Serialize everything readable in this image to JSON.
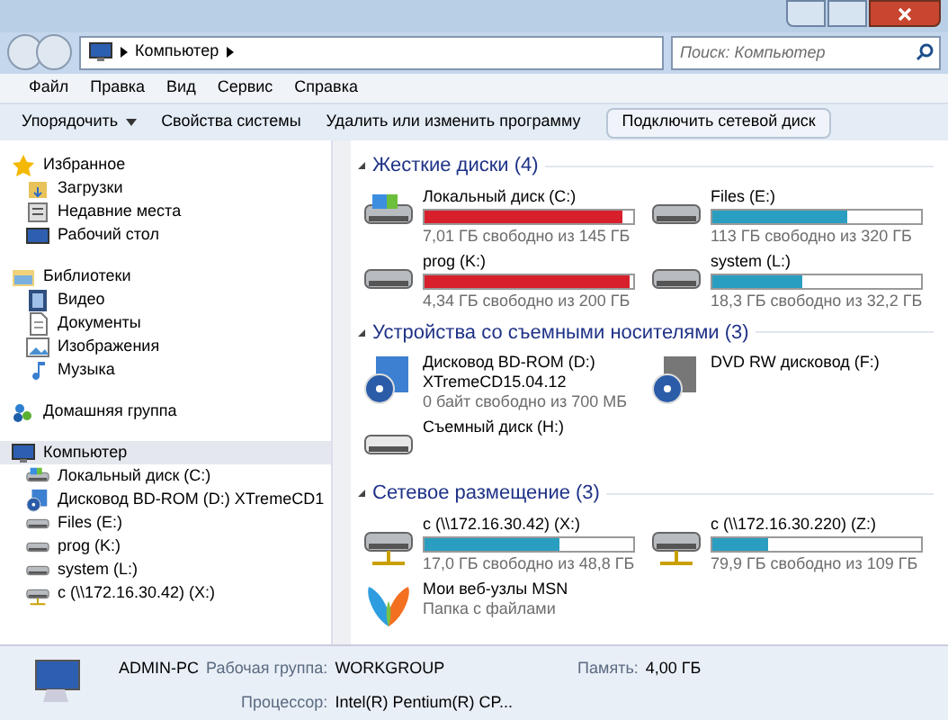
{
  "address_bar": {
    "path": "Компьютер",
    "search_placeholder": "Поиск: Компьютер"
  },
  "menu": [
    "Файл",
    "Правка",
    "Вид",
    "Сервис",
    "Справка"
  ],
  "toolbar": [
    {
      "label": "Упорядочить",
      "kind": "dropdown"
    },
    {
      "label": "Свойства системы",
      "kind": "plain"
    },
    {
      "label": "Удалить или изменить программу",
      "kind": "plain"
    },
    {
      "label": "Подключить сетевой диск",
      "kind": "framed"
    }
  ],
  "sidebar": {
    "groups": [
      {
        "label": "Избранное",
        "kind": "star",
        "children": [
          {
            "label": "Загрузки",
            "kind": "folder"
          },
          {
            "label": "Недавние места",
            "kind": "recent"
          },
          {
            "label": "Рабочий стол",
            "kind": "desktop"
          }
        ]
      },
      {
        "label": "Библиотеки",
        "kind": "library",
        "children": [
          {
            "label": "Видео",
            "kind": "video"
          },
          {
            "label": "Документы",
            "kind": "document"
          },
          {
            "label": "Изображения",
            "kind": "image"
          },
          {
            "label": "Музыка",
            "kind": "music"
          }
        ]
      },
      {
        "label": "Домашняя группа",
        "kind": "homegroup"
      },
      {
        "label": "Компьютер",
        "kind": "computer",
        "selected": true,
        "children": [
          {
            "label": "Локальный диск (C:)",
            "kind": "windrive"
          },
          {
            "label": "Дисковод BD-ROM (D:) XTremeCD1",
            "kind": "cd"
          },
          {
            "label": "Files (E:)",
            "kind": "drive"
          },
          {
            "label": "prog (K:)",
            "kind": "drive"
          },
          {
            "label": "system (L:)",
            "kind": "drive"
          },
          {
            "label": "c (\\\\172.16.30.42) (X:)",
            "kind": "netdrive"
          }
        ]
      }
    ]
  },
  "sections": [
    {
      "title": "Жесткие диски (4)",
      "items": [
        {
          "name": "Локальный диск (C:)",
          "kind": "windrive",
          "level": 0.95,
          "low_space": true,
          "info": "7,01 ГБ свободно из 145 ГБ"
        },
        {
          "name": "Files (E:)",
          "kind": "drive",
          "level": 0.65,
          "low_space": false,
          "info": "113 ГБ свободно из 320 ГБ"
        },
        {
          "name": "prog (K:)",
          "kind": "drive",
          "level": 0.98,
          "low_space": true,
          "info": "4,34 ГБ свободно из 200 ГБ"
        },
        {
          "name": "system (L:)",
          "kind": "drive",
          "level": 0.43,
          "low_space": false,
          "info": "18,3 ГБ свободно из 32,2 ГБ"
        }
      ]
    },
    {
      "title": "Устройства со съемными носителями (3)",
      "items": [
        {
          "name": "Дисковод BD-ROM (D:)",
          "name2": "XTremeCD15.04.12",
          "kind": "cd",
          "info": "0 байт свободно из 700 МБ"
        },
        {
          "name": "DVD RW дисковод (F:)",
          "kind": "dvd"
        },
        {
          "name": "Съемный диск (H:)",
          "kind": "removable"
        }
      ]
    },
    {
      "title": "Сетевое размещение (3)",
      "items": [
        {
          "name": "c (\\\\172.16.30.42) (X:)",
          "kind": "netdrive",
          "level": 0.65,
          "low_space": false,
          "info": "17,0 ГБ свободно из 48,8 ГБ"
        },
        {
          "name": "c (\\\\172.16.30.220) (Z:)",
          "kind": "netdrive",
          "level": 0.27,
          "low_space": false,
          "info": "79,9 ГБ свободно из 109 ГБ"
        },
        {
          "name": "Мои веб-узлы MSN",
          "kind": "msn",
          "info": "Папка с файлами"
        }
      ]
    }
  ],
  "details": {
    "computer_name": "ADMIN-PC",
    "fields": [
      {
        "label": "Рабочая группа:",
        "value": "WORKGROUP"
      },
      {
        "label": "Память:",
        "value": "4,00 ГБ"
      },
      {
        "label": "Процессор:",
        "value": "Intel(R) Pentium(R) CP..."
      }
    ]
  }
}
